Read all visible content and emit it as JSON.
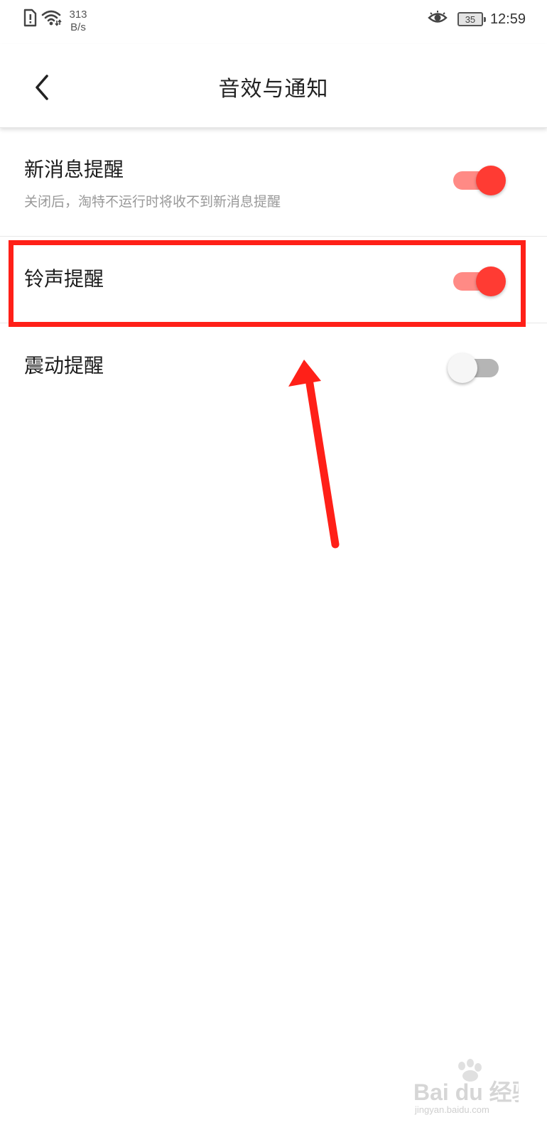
{
  "status_bar": {
    "network_speed_value": "313",
    "network_speed_unit": "B/s",
    "battery_level": "35",
    "time": "12:59",
    "icons": [
      "sim-alert-icon",
      "wifi-icon",
      "eye-icon",
      "battery-icon"
    ]
  },
  "header": {
    "title": "音效与通知",
    "back_icon": "chevron-left-icon"
  },
  "settings": [
    {
      "title": "新消息提醒",
      "subtitle": "关闭后，淘特不运行时将收不到新消息提醒",
      "enabled": true
    },
    {
      "title": "铃声提醒",
      "enabled": true
    },
    {
      "title": "震动提醒",
      "enabled": false
    }
  ],
  "colors": {
    "accent": "#ff3b33",
    "toggle_track_on": "#ff8a85",
    "toggle_track_off": "#b5b5b5",
    "annotation_red": "#ff2018"
  },
  "watermark": {
    "brand": "Bai du 经验",
    "url": "jingyan.baidu.com"
  }
}
